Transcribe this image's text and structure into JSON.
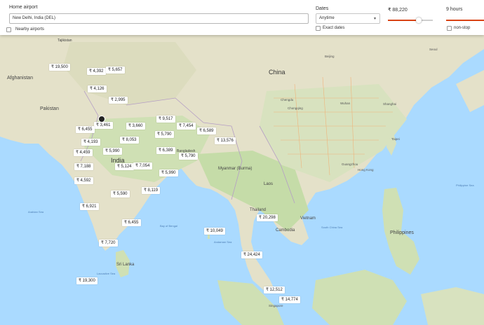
{
  "filters": {
    "home_airport_label": "Home airport",
    "home_airport_value": "New Delhi, India (DEL)",
    "nearby_airports_label": "Nearby airports",
    "dates_label": "Dates",
    "dates_value": "Anytime",
    "exact_dates_label": "Exact dates",
    "price_label": "₹ 88,220",
    "duration_label": "9 hours",
    "nonstop_label": "non-stop",
    "accent_color": "#d84315"
  },
  "map": {
    "countries": [
      "Afghanistan",
      "Pakistan",
      "India",
      "China",
      "Myanmar (Burma)",
      "Laos",
      "Thailand",
      "Cambodia",
      "Vietnam",
      "Philippines",
      "Sri Lanka",
      "Bangladesh",
      "Tajikistan",
      "Mongolia",
      "Nepal",
      "Bhutan"
    ],
    "seas": [
      "Bay of Bengal",
      "Arabian Sea",
      "Laccadive Sea",
      "Andaman Sea",
      "South China Sea",
      "Philippine Sea",
      "Gulf of Thailand",
      "Celebes Sea"
    ],
    "cities": [
      "Beijing",
      "Shanghai",
      "Chengdu",
      "Chongqing",
      "Wuhan",
      "Guangzhou",
      "Hong Kong",
      "Taipei",
      "Seoul",
      "Singapore",
      "Kolkata",
      "Dhaka",
      "Bangkok",
      "Hanoi",
      "Manila",
      "Kathmandu"
    ]
  },
  "prices": [
    {
      "label": "₹ 19,500"
    },
    {
      "label": "₹ 4,392"
    },
    {
      "label": "₹ 5,657"
    },
    {
      "label": "₹ 4,126"
    },
    {
      "label": "₹ 2,995"
    },
    {
      "label": "₹ 3,461"
    },
    {
      "label": "₹ 6,455"
    },
    {
      "label": "₹ 3,660"
    },
    {
      "label": "₹ 9,517"
    },
    {
      "label": "₹ 7,454"
    },
    {
      "label": "₹ 6,589"
    },
    {
      "label": "₹ 5,790"
    },
    {
      "label": "₹ 8,053"
    },
    {
      "label": "₹ 4,193"
    },
    {
      "label": "₹ 13,576"
    },
    {
      "label": "₹ 5,990"
    },
    {
      "label": "₹ 4,459"
    },
    {
      "label": "₹ 6,389"
    },
    {
      "label": "₹ 5,790"
    },
    {
      "label": "₹ 7,188"
    },
    {
      "label": "₹ 5,124"
    },
    {
      "label": "₹ 7,054"
    },
    {
      "label": "₹ 5,990"
    },
    {
      "label": "₹ 4,592"
    },
    {
      "label": "₹ 8,119"
    },
    {
      "label": "₹ 5,590"
    },
    {
      "label": "₹ 6,921"
    },
    {
      "label": "₹ 20,298"
    },
    {
      "label": "₹ 6,455"
    },
    {
      "label": "₹ 10,049"
    },
    {
      "label": "₹ 7,720"
    },
    {
      "label": "₹ 24,424"
    },
    {
      "label": "₹ 19,300"
    },
    {
      "label": "₹ 12,512"
    },
    {
      "label": "₹ 14,774"
    }
  ]
}
